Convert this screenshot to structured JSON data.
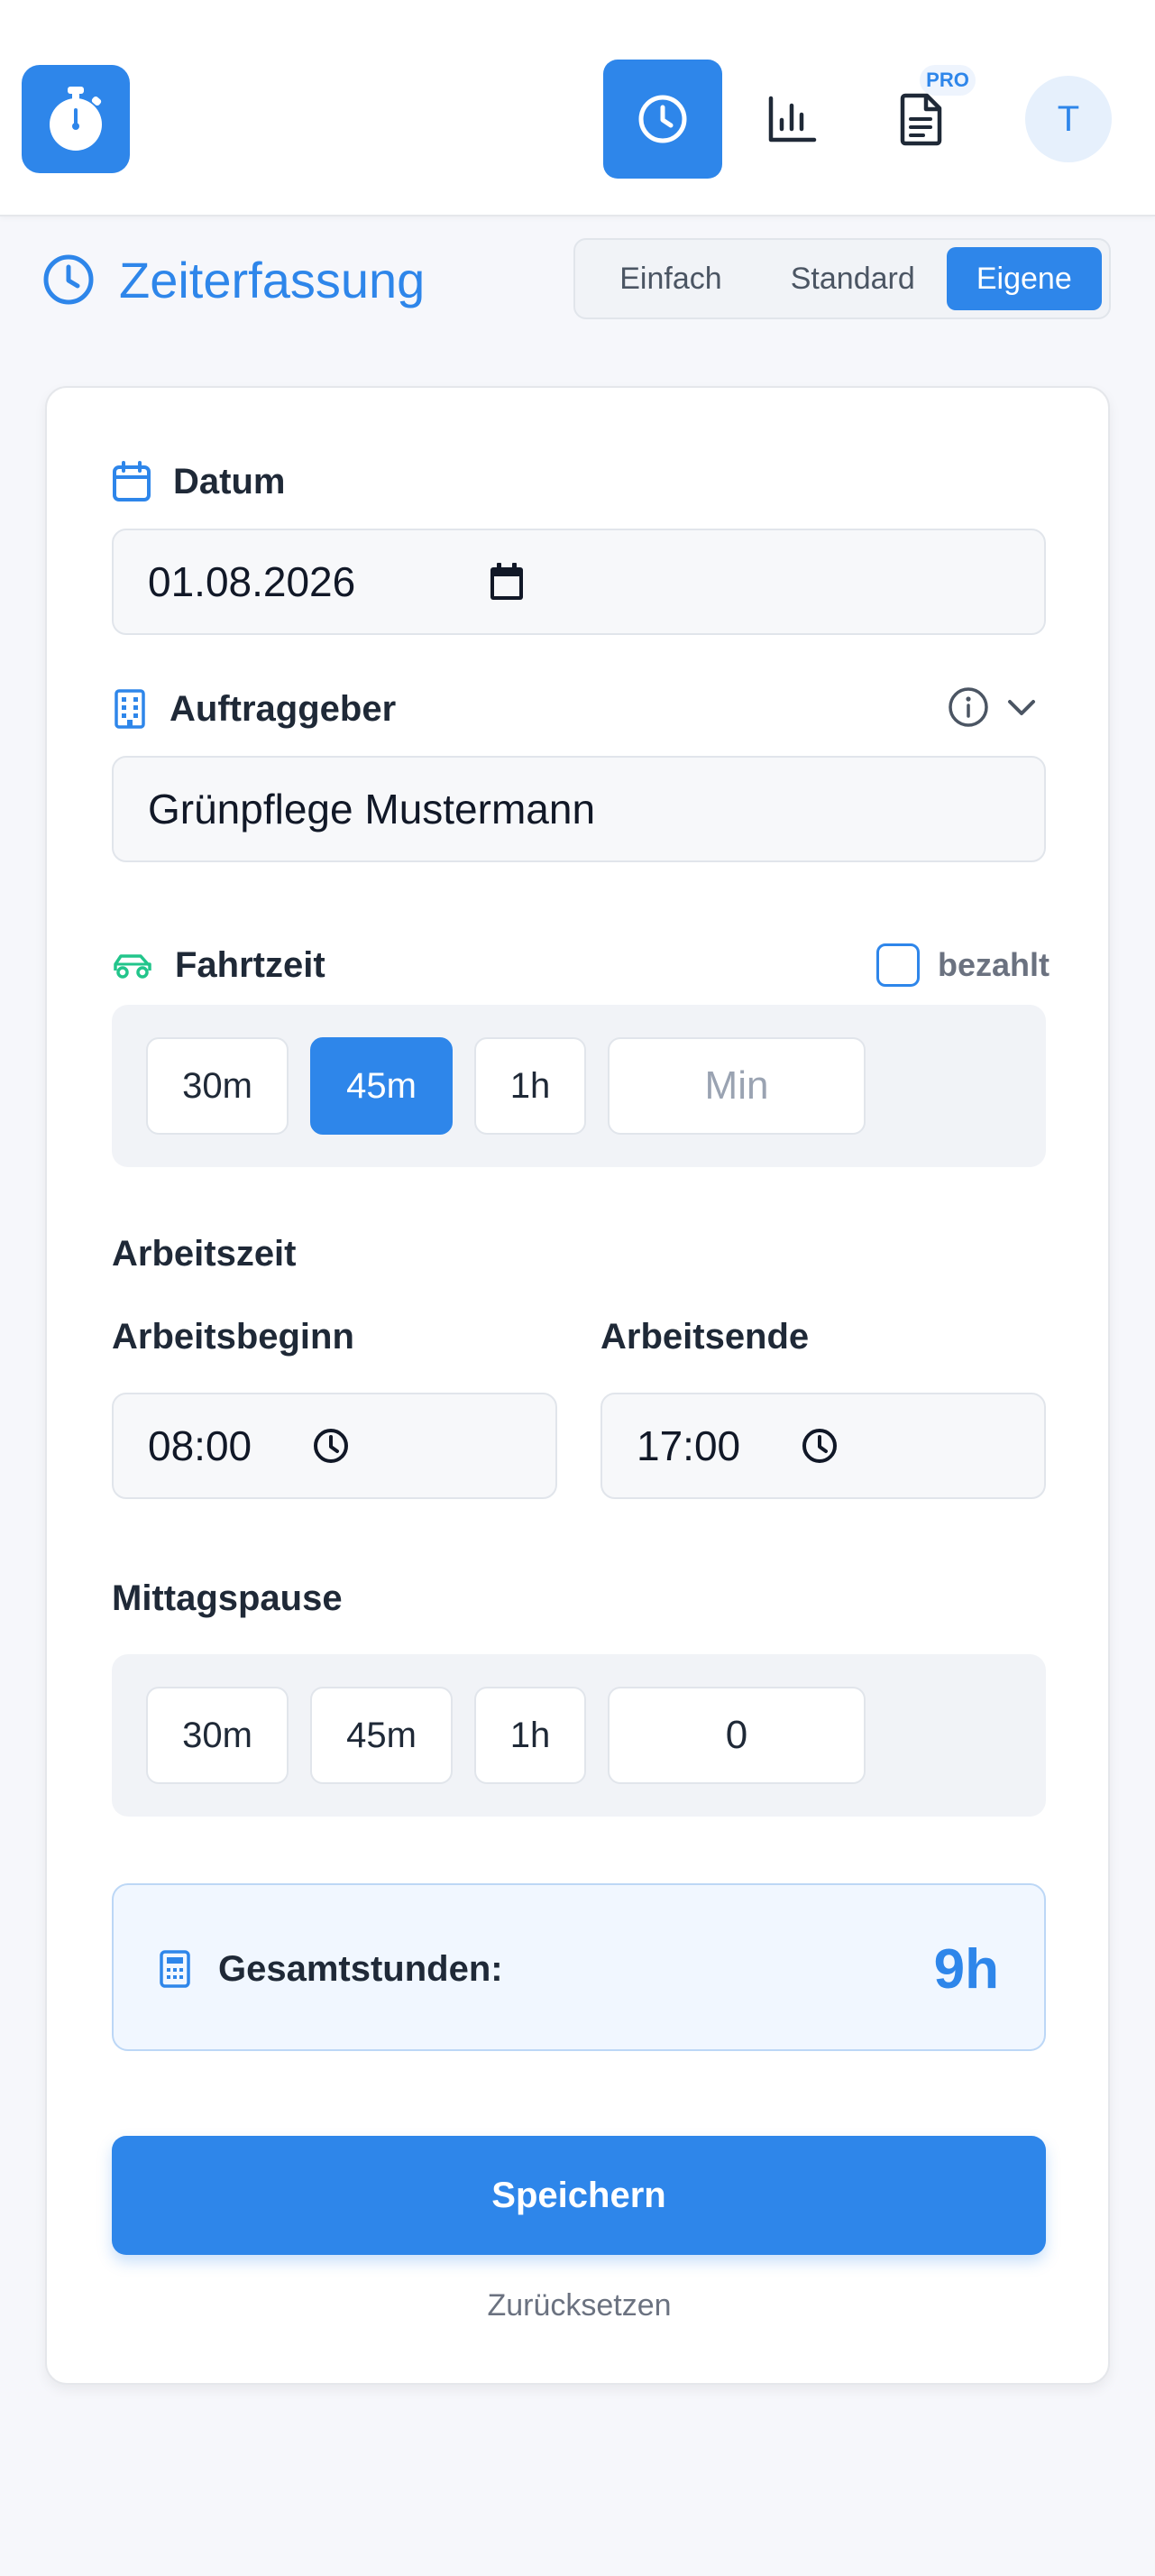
{
  "header": {
    "nav": {
      "time_label": "Zeiterfassung",
      "pro_badge": "PRO"
    },
    "avatar_initial": "T"
  },
  "page": {
    "title": "Zeiterfassung",
    "modes": [
      "Einfach",
      "Standard",
      "Eigene"
    ],
    "active_mode": "Eigene"
  },
  "form": {
    "date": {
      "label": "Datum",
      "value": "01.08.2026"
    },
    "client": {
      "label": "Auftraggeber",
      "value": "Grünpflege Mustermann"
    },
    "travel": {
      "label": "Fahrtzeit",
      "paid_label": "bezahlt",
      "paid_checked": false,
      "presets": [
        "30m",
        "45m",
        "1h"
      ],
      "active_preset": "45m",
      "custom_placeholder": "Min"
    },
    "work": {
      "section_label": "Arbeitszeit",
      "start_label": "Arbeitsbeginn",
      "start_value": "08:00",
      "end_label": "Arbeitsende",
      "end_value": "17:00"
    },
    "lunch": {
      "label": "Mittagspause",
      "presets": [
        "30m",
        "45m",
        "1h"
      ],
      "custom_value": "0"
    },
    "summary": {
      "label": "Gesamtstunden:",
      "value": "9h"
    },
    "save_label": "Speichern",
    "reset_label": "Zurücksetzen"
  },
  "colors": {
    "primary": "#2e86ea",
    "travel_icon": "#22c58b",
    "muted_text": "#6b7280"
  },
  "icons": {
    "logo": "stopwatch-icon",
    "nav": [
      "clock-icon",
      "bar-chart-icon",
      "document-icon"
    ],
    "date": "calendar-icon",
    "client": "building-icon",
    "travel": "car-icon",
    "summary": "calculator-icon"
  }
}
